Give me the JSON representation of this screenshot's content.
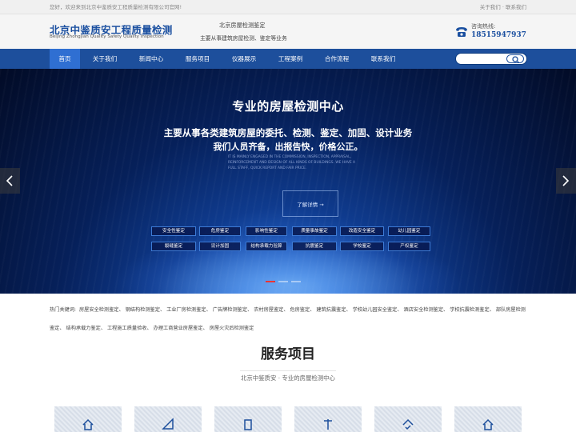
{
  "topbar": {
    "welcome": "您好，欢迎来到北京中鉴质安工程质量检测有限公司官网!",
    "about": "关于我们",
    "contact": "联系我们",
    "sep": "·"
  },
  "header": {
    "logo_cn": "北京中鉴质安工程质量检测",
    "logo_en": "Beijing Zhongjian Quality Safety Quality Inspection",
    "slogan_1": "北京房屋检测鉴定",
    "slogan_2": "主要从事建筑房屋检测、鉴定等业务",
    "hotline_label": "咨询热线:",
    "hotline_number": "18515947937"
  },
  "nav": {
    "items": [
      {
        "label": "首页"
      },
      {
        "label": "关于我们"
      },
      {
        "label": "新闻中心"
      },
      {
        "label": "服务项目"
      },
      {
        "label": "仪器展示"
      },
      {
        "label": "工程案例"
      },
      {
        "label": "合作流程"
      },
      {
        "label": "联系我们"
      }
    ],
    "search_placeholder": ""
  },
  "banner": {
    "title": "专业的房屋检测中心",
    "line_1": "主要从事各类建筑房屋的委托、检测、鉴定、加固、设计业务",
    "line_2": "我们人员齐备，出报告快，价格公正。",
    "en_text": "IT IS MAINLY ENGAGED IN THE COMMISSION, INSPECTION, APPRAISAL, REINFORCEMENT AND DESIGN OF ALL KINDS OF BUILDINGS. WE HAVE A FULL STAFF, QUICK REPORT AND FAIR PRICE.",
    "more": "了解详情 →",
    "tags_row_1": [
      "安全性鉴定",
      "危房鉴定",
      "影响性鉴定",
      "质量事故鉴定",
      "改造安全鉴定",
      "幼儿园鉴定"
    ],
    "tags_row_2": [
      "裂缝鉴定",
      "设计加固",
      "结构承载力验算",
      "抗震鉴定",
      "学校鉴定",
      "产权鉴定"
    ]
  },
  "keywords": {
    "label": "热门关键词:",
    "items": [
      "房屋安全检测鉴定",
      "钢结构检测鉴定",
      "工业厂房检测鉴定",
      "广告牌检测鉴定",
      "农村房屋鉴定",
      "危房鉴定",
      "建筑抗震鉴定",
      "学校幼儿园安全鉴定",
      "酒店安全检测鉴定",
      "学校抗震检测鉴定",
      "部队房屋检测鉴定",
      "结构承载力鉴定",
      "工程施工质量验收",
      "办理工商营业房屋鉴定",
      "房屋火灾后检测鉴定"
    ]
  },
  "services": {
    "title": "服务项目",
    "subtitle": "北京中鉴质安 · 专业的房屋检测中心"
  },
  "colors": {
    "brand_blue": "#1d4f9c",
    "nav_active": "#2f6fd2",
    "dot_active": "#ee3333"
  }
}
